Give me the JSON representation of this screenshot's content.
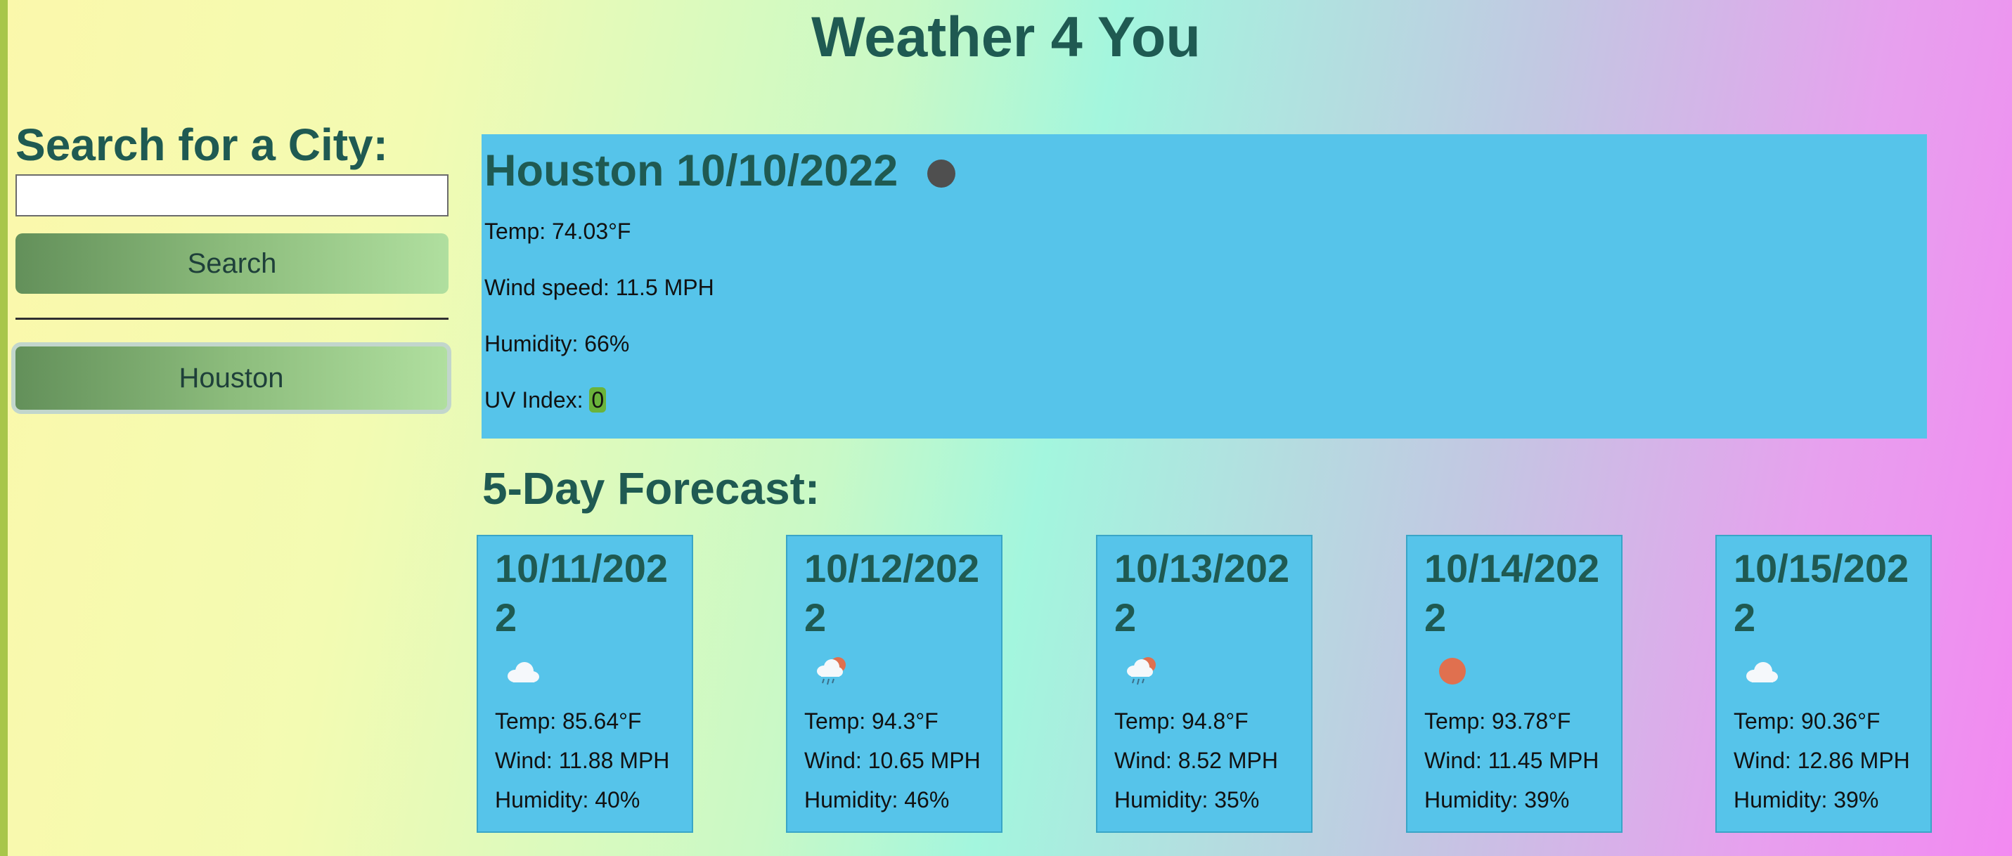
{
  "title": "Weather 4 You",
  "sidebar": {
    "heading": "Search for a City:",
    "input_value": "",
    "search_label": "Search",
    "history": [
      "Houston"
    ]
  },
  "current": {
    "title": "Houston 10/10/2022",
    "icon": "dark-dot-icon",
    "temp": "Temp: 74.03°F",
    "wind": "Wind speed: 11.5 MPH",
    "humidity": "Humidity: 66%",
    "uv_label": "UV Index:",
    "uv_value": "0",
    "uv_color": "#6ab33a"
  },
  "forecast_heading": "5-Day Forecast:",
  "forecast": [
    {
      "date": "10/11/2022",
      "icon": "cloud-icon",
      "temp": "Temp: 85.64°F",
      "wind": "Wind: 11.88 MPH",
      "humidity": "Humidity: 40%"
    },
    {
      "date": "10/12/2022",
      "icon": "sun-rain-cloud-icon",
      "temp": "Temp: 94.3°F",
      "wind": "Wind: 10.65 MPH",
      "humidity": "Humidity: 46%"
    },
    {
      "date": "10/13/2022",
      "icon": "sun-rain-cloud-icon",
      "temp": "Temp: 94.8°F",
      "wind": "Wind: 8.52 MPH",
      "humidity": "Humidity: 35%"
    },
    {
      "date": "10/14/2022",
      "icon": "sun-icon",
      "temp": "Temp: 93.78°F",
      "wind": "Wind: 11.45 MPH",
      "humidity": "Humidity: 39%"
    },
    {
      "date": "10/15/2022",
      "icon": "cloud-icon",
      "temp": "Temp: 90.36°F",
      "wind": "Wind: 12.86 MPH",
      "humidity": "Humidity: 39%"
    }
  ],
  "colors": {
    "panel": "#56c4ea",
    "heading": "#1f5a52",
    "sun": "#e0704f",
    "button_gradient": [
      "#63905a",
      "#b0df9f"
    ]
  }
}
